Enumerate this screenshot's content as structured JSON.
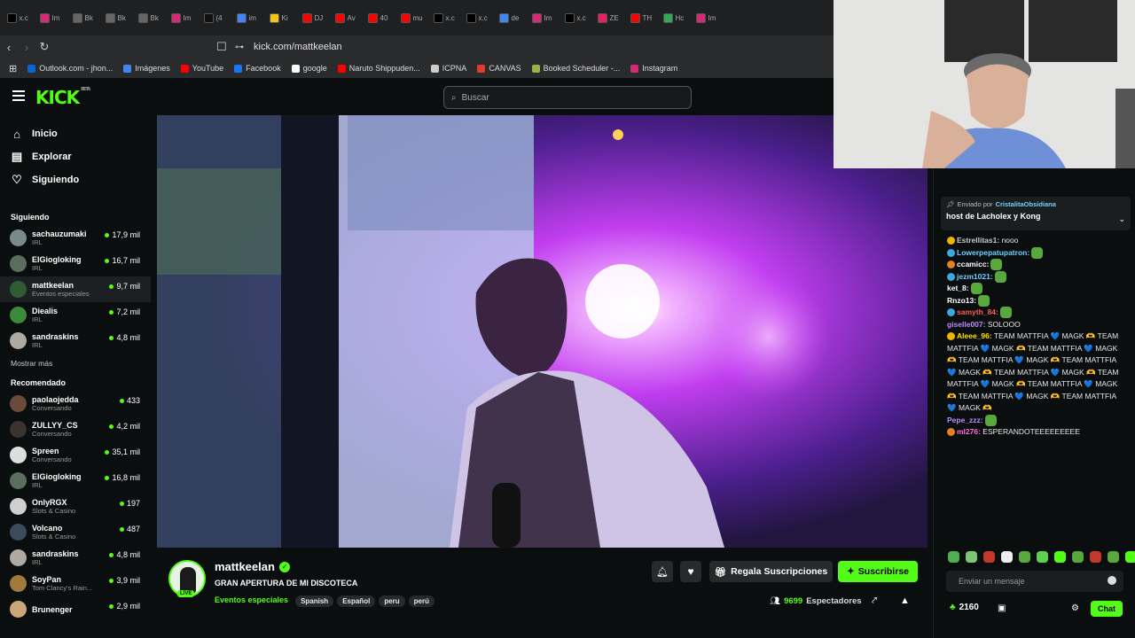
{
  "browser": {
    "tabs": [
      {
        "label": "x.c",
        "color": "#000"
      },
      {
        "label": "Im",
        "color": "#d62976"
      },
      {
        "label": "Bk",
        "color": "#666"
      },
      {
        "label": "Bk",
        "color": "#666"
      },
      {
        "label": "Bk",
        "color": "#666"
      },
      {
        "label": "Im",
        "color": "#d62976"
      },
      {
        "label": "(4",
        "color": "#111"
      },
      {
        "label": "im",
        "color": "#4285f4"
      },
      {
        "label": "Ki",
        "color": "#f5c518"
      },
      {
        "label": "DJ",
        "color": "#ff0000"
      },
      {
        "label": "Av",
        "color": "#ff0000"
      },
      {
        "label": "40",
        "color": "#ff0000"
      },
      {
        "label": "mu",
        "color": "#ff0000"
      },
      {
        "label": "x.c",
        "color": "#000"
      },
      {
        "label": "x.c",
        "color": "#000"
      },
      {
        "label": "de",
        "color": "#4285f4"
      },
      {
        "label": "Im",
        "color": "#d62976"
      },
      {
        "label": "x.c",
        "color": "#000"
      },
      {
        "label": "ZE",
        "color": "#e91e63"
      },
      {
        "label": "TH",
        "color": "#ff0000"
      },
      {
        "label": "Hc",
        "color": "#34a853"
      },
      {
        "label": "Im",
        "color": "#d62976"
      }
    ],
    "url": "kick.com/mattkeelan",
    "bookmarks": [
      {
        "label": "Outlook.com - jhon...",
        "color": "#0a64d8"
      },
      {
        "label": "Imágenes",
        "color": "#4285f4"
      },
      {
        "label": "YouTube",
        "color": "#ff0000"
      },
      {
        "label": "Facebook",
        "color": "#1877f2"
      },
      {
        "label": "google",
        "color": "#ffffff"
      },
      {
        "label": "Naruto Shippuden...",
        "color": "#ff0000"
      },
      {
        "label": "ICPNA",
        "color": "#cccccc"
      },
      {
        "label": "CANVAS",
        "color": "#e43a2a"
      },
      {
        "label": "Booked Scheduler -...",
        "color": "#9bb04a"
      },
      {
        "label": "Instagram",
        "color": "#d62976"
      }
    ]
  },
  "kick": {
    "logo": "KICK",
    "logo_sup": "BETA",
    "search_placeholder": "Buscar",
    "accent": "#53fc18"
  },
  "sidebar": {
    "nav": [
      {
        "label": "Inicio",
        "icon": "home-icon"
      },
      {
        "label": "Explorar",
        "icon": "compass-icon"
      },
      {
        "label": "Siguiendo",
        "icon": "heart-icon"
      }
    ],
    "following_title": "Siguiendo",
    "following": [
      {
        "name": "sachauzumaki",
        "category": "IRL",
        "viewers": "17,9 mil",
        "color": "#7a8a8c"
      },
      {
        "name": "ElGiogloking",
        "category": "IRL",
        "viewers": "16,7 mil",
        "color": "#5b6d5c"
      },
      {
        "name": "mattkeelan",
        "category": "Eventos especiales",
        "viewers": "9,7 mil",
        "color": "#2f5c33",
        "active": true
      },
      {
        "name": "Diealis",
        "category": "IRL",
        "viewers": "7,2 mil",
        "color": "#3a8a3a"
      },
      {
        "name": "sandraskins",
        "category": "IRL",
        "viewers": "4,8 mil",
        "color": "#b0a9a2"
      }
    ],
    "show_more": "Mostrar más",
    "recommended_title": "Recomendado",
    "recommended": [
      {
        "name": "paolaojedda",
        "category": "Conversando",
        "viewers": "433",
        "color": "#6a4b3a"
      },
      {
        "name": "ZULLYY_CS",
        "category": "Conversando",
        "viewers": "4,2 mil",
        "color": "#3b3330"
      },
      {
        "name": "Spreen",
        "category": "Conversando",
        "viewers": "35,1 mil",
        "color": "#dddddd"
      },
      {
        "name": "ElGiogloking",
        "category": "IRL",
        "viewers": "16,8 mil",
        "color": "#5b6d5c"
      },
      {
        "name": "OnlyRGX",
        "category": "Slots & Casino",
        "viewers": "197",
        "color": "#cfcfcf"
      },
      {
        "name": "Volcano",
        "category": "Slots & Casino",
        "viewers": "487",
        "color": "#3a4b5a"
      },
      {
        "name": "sandraskins",
        "category": "IRL",
        "viewers": "4,8 mil",
        "color": "#b0a9a2"
      },
      {
        "name": "SoyPan",
        "category": "Tom Clancy's Rain...",
        "viewers": "3,9 mil",
        "color": "#a07a3a"
      },
      {
        "name": "Brunenger",
        "category": "",
        "viewers": "2,9 mil",
        "color": "#c9a77a"
      }
    ]
  },
  "stream": {
    "channel": "mattkeelan",
    "title": "GRAN APERTURA DE MI DISCOTECA",
    "category": "Eventos especiales",
    "tags": [
      "Spanish",
      "Español",
      "peru",
      "perú"
    ],
    "live_badge": "LIVE",
    "gift_label": "Regala Suscripciones",
    "subscribe_label": "Suscribirse",
    "viewers_count": "9699",
    "viewers_label": "Espectadores"
  },
  "chat": {
    "pinned_by_label": "Enviado por",
    "pinned_by_user": "CristalitaObsidiana",
    "pinned_text": "host de Lacholex y Kong",
    "messages": [
      {
        "user": "Estrellitas1:",
        "text": " nooo",
        "color": "#c9c9c9",
        "badge": "#f0b400"
      },
      {
        "user": "Lowerpepatupatron:",
        "text": "",
        "color": "#6fd0ff",
        "badge": "#3ba8e0",
        "emote": true
      },
      {
        "user": "ccamicc:",
        "text": "",
        "color": "#ffffff",
        "badge": "#e67e22",
        "emote": true
      },
      {
        "user": "jezm1021:",
        "text": "",
        "color": "#6fd0ff",
        "badge": "#3ba8e0",
        "emote": true
      },
      {
        "user": "ket_8:",
        "text": "",
        "color": "#ffffff",
        "badge": "",
        "emote": true
      },
      {
        "user": "Rnzo13:",
        "text": "",
        "color": "#ffffff",
        "badge": "",
        "emote": true
      },
      {
        "user": "samyth_84:",
        "text": "",
        "color": "#ff5a5a",
        "badge": "#3ba8e0",
        "emote": true
      },
      {
        "user": "giselle007:",
        "text": " SOLOOO",
        "color": "#b98cff",
        "badge": ""
      },
      {
        "user": "Aleee_96:",
        "text": " TEAM MATTFIA 💙 MAGK 🫶 TEAM MATTFIA 💙 MAGK 🫶 TEAM MATTFIA 💙 MAGK 🫶 TEAM MATTFIA 💙 MAGK 🫶 TEAM MATTFIA 💙 MAGK 🫶 TEAM MATTFIA 💙 MAGK 🫶 TEAM MATTFIA 💙 MAGK 🫶 TEAM MATTFIA 💙 MAGK 🫶 TEAM MATTFIA 💙 MAGK 🫶 TEAM MATTFIA 💙 MAGK 🫶",
        "color": "#ffe100",
        "badge": "#f0b400"
      },
      {
        "user": "Pepe_zzz:",
        "text": "",
        "color": "#b98cff",
        "badge": "",
        "emote": true
      },
      {
        "user": "ml276:",
        "text": " ESPERANDOTEEEEEEEEE",
        "color": "#ff6bd5",
        "badge": "#e67e22"
      }
    ],
    "input_placeholder": "Enviar un mensaje",
    "points": "2160",
    "send_label": "Chat"
  }
}
